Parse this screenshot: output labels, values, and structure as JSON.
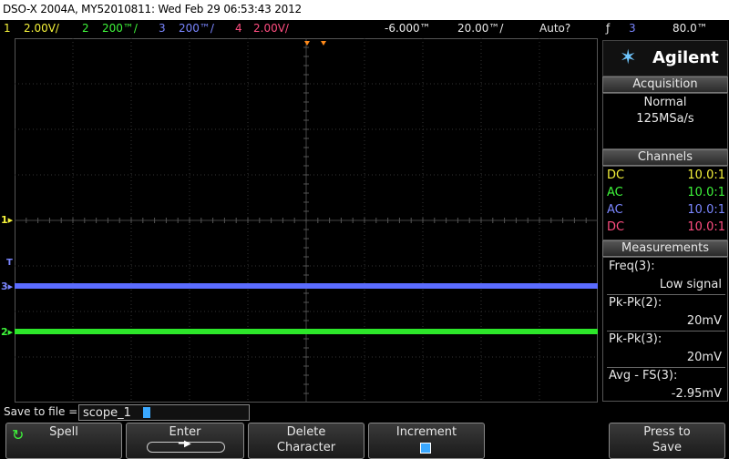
{
  "title": "DSO-X 2004A, MY52010811: Wed Feb 29 06:53:43 2012",
  "status": {
    "ch1_num": "1",
    "ch1_scale": "2.00V/",
    "ch2_num": "2",
    "ch2_scale": "200™/",
    "ch3_num": "3",
    "ch3_scale": "200™/",
    "ch4_num": "4",
    "ch4_scale": "2.00V/",
    "time_offset": "-6.000™",
    "time_scale": "20.00™/",
    "trigger_mode": "Auto?",
    "trigger_symbol": "ƒ",
    "trigger_source": "3",
    "trigger_level": "80.0™"
  },
  "markers": {
    "ch1": "1▸",
    "ch3": "3▸",
    "ch2": "2▸",
    "trig": "T"
  },
  "traces": {
    "ch3_level": 0.68,
    "ch2_level": 0.805
  },
  "panel": {
    "logo_mark": "✶",
    "logo_text": "Agilent",
    "acquisition_header": "Acquisition",
    "acq_mode": "Normal",
    "acq_rate": "125MSa/s",
    "channels_header": "Channels",
    "channels": [
      {
        "coupling": "DC",
        "probe": "10.0:1",
        "color": "#f5f23a"
      },
      {
        "coupling": "AC",
        "probe": "10.0:1",
        "color": "#3ef53a"
      },
      {
        "coupling": "AC",
        "probe": "10.0:1",
        "color": "#7a86ff"
      },
      {
        "coupling": "DC",
        "probe": "10.0:1",
        "color": "#ff4d80"
      }
    ],
    "measurements_header": "Measurements",
    "measurements": [
      {
        "label": "Freq(3):",
        "value": "Low signal"
      },
      {
        "label": "Pk-Pk(2):",
        "value": "20mV"
      },
      {
        "label": "Pk-Pk(3):",
        "value": "20mV"
      },
      {
        "label": "Avg - FS(3):",
        "value": "-2.95mV"
      }
    ]
  },
  "save": {
    "label": "Save to file =",
    "filename": "scope_1"
  },
  "softkeys": {
    "spell": "Spell",
    "enter": "Enter",
    "enter_arrow": "━▶",
    "delete_1": "Delete",
    "delete_2": "Character",
    "increment": "Increment",
    "press_1": "Press to",
    "press_2": "Save"
  },
  "colors": {
    "ch1": "#f5f23a",
    "ch2": "#3ef53a",
    "ch3": "#7a86ff",
    "ch4": "#ff4d80",
    "grid": "#333333",
    "trigger_marker": "#ff8a1a"
  }
}
